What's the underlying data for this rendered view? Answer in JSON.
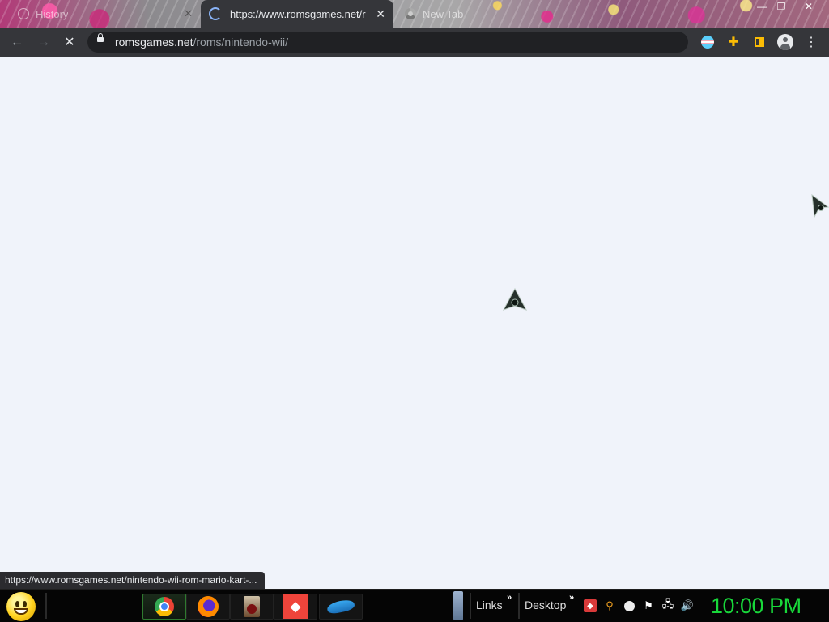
{
  "browser": {
    "tabs": [
      {
        "label": "History",
        "close": "✕"
      },
      {
        "label": "https://www.romsgames.net/rom",
        "close": "✕"
      },
      {
        "label": "New Tab"
      }
    ],
    "window_controls": {
      "minimize": "—",
      "maximize": "❐",
      "close": "✕"
    },
    "nav": {
      "back": "←",
      "forward": "→",
      "stop": "✕"
    },
    "address": {
      "domain": "romsgames.net",
      "path": "/roms/nintendo-wii/"
    },
    "toolbar_icons": [
      "share-icon",
      "bookmark-star-icon",
      "profile-flag-icon",
      "extensions-icon",
      "sidebar-icon",
      "account-icon",
      "menu-icon"
    ],
    "status_url": "https://www.romsgames.net/nintendo-wii-rom-mario-kart-..."
  },
  "taskbar": {
    "apps": [
      "Google Chrome",
      "Firefox",
      "Game",
      "AnyDesk",
      "Dolphin"
    ],
    "links_label": "Links",
    "desktop_label": "Desktop",
    "chevron": "»",
    "clock": "10:00 PM"
  }
}
